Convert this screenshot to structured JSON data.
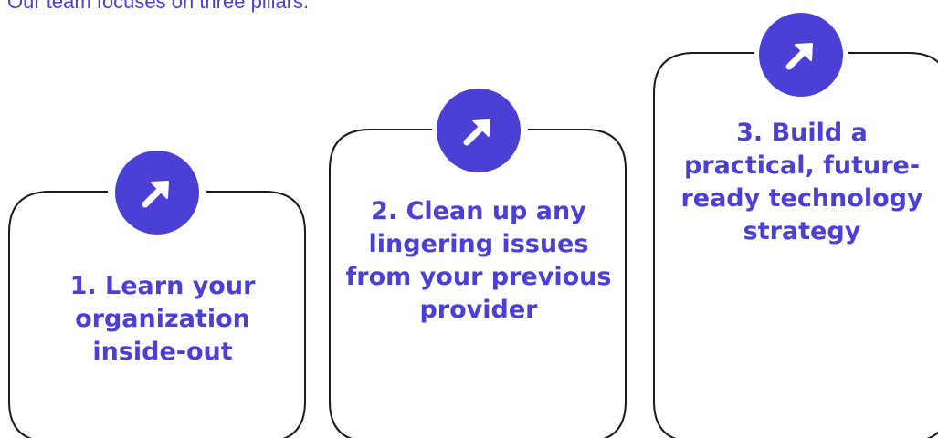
{
  "intro": "Our team focuses on three pillars:",
  "colors": {
    "accent": "#4b3fd6",
    "border": "#1a1a1a",
    "background": "#ffffff"
  },
  "pillars": [
    {
      "text": "1.  Learn your organization inside-out",
      "icon": "arrow-up-right-icon"
    },
    {
      "text": "2. Clean up any lingering issues from your previous provider",
      "icon": "arrow-up-right-icon"
    },
    {
      "text": "3. Build a practical, future-ready technology strategy",
      "icon": "arrow-up-right-icon"
    }
  ]
}
